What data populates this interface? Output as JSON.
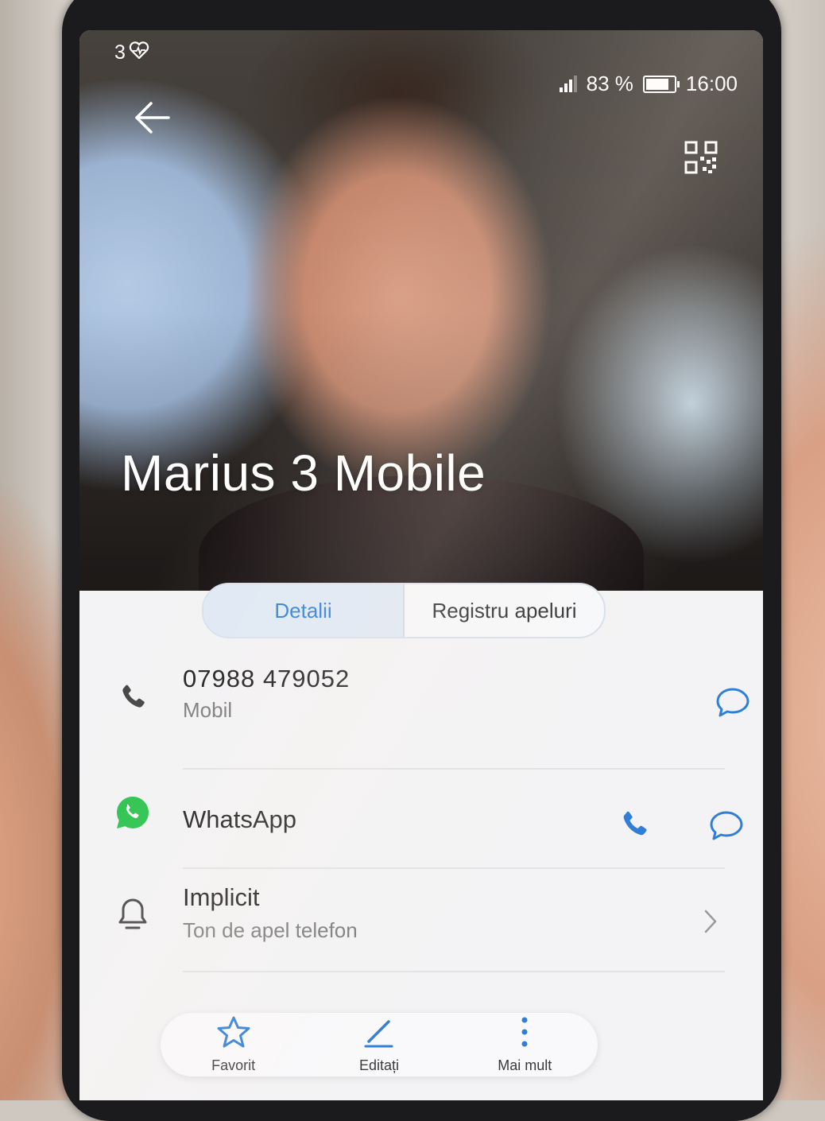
{
  "status_bar": {
    "notification_count": "3",
    "signal_level": 3,
    "battery_percent": "83 %",
    "battery_level": 0.83,
    "time": "16:00"
  },
  "header": {
    "contact_name": "Marius 3 Mobile"
  },
  "tabs": [
    {
      "label": "Detalii",
      "active": true
    },
    {
      "label": "Registru apeluri",
      "active": false
    }
  ],
  "details": {
    "phone": {
      "number": "07988 479052",
      "type": "Mobil"
    },
    "whatsapp": {
      "label": "WhatsApp"
    },
    "ringtone": {
      "title": "Implicit",
      "subtitle": "Ton de apel telefon"
    }
  },
  "bottom_bar": {
    "favorite_label": "Favorit",
    "edit_label": "Editați",
    "more_label": "Mai mult"
  },
  "colors": {
    "accent": "#2f7fd6",
    "whatsapp": "#25c24a",
    "tab_active_bg": "#dfe9f5"
  },
  "icons": {
    "back": "arrow-left-icon",
    "qr": "qr-code-icon",
    "phone": "phone-icon",
    "message": "message-bubble-icon",
    "whatsapp": "whatsapp-icon",
    "bell": "bell-icon",
    "chevron": "chevron-right-icon",
    "star": "star-icon",
    "pencil": "pencil-icon",
    "more": "more-vertical-icon"
  }
}
